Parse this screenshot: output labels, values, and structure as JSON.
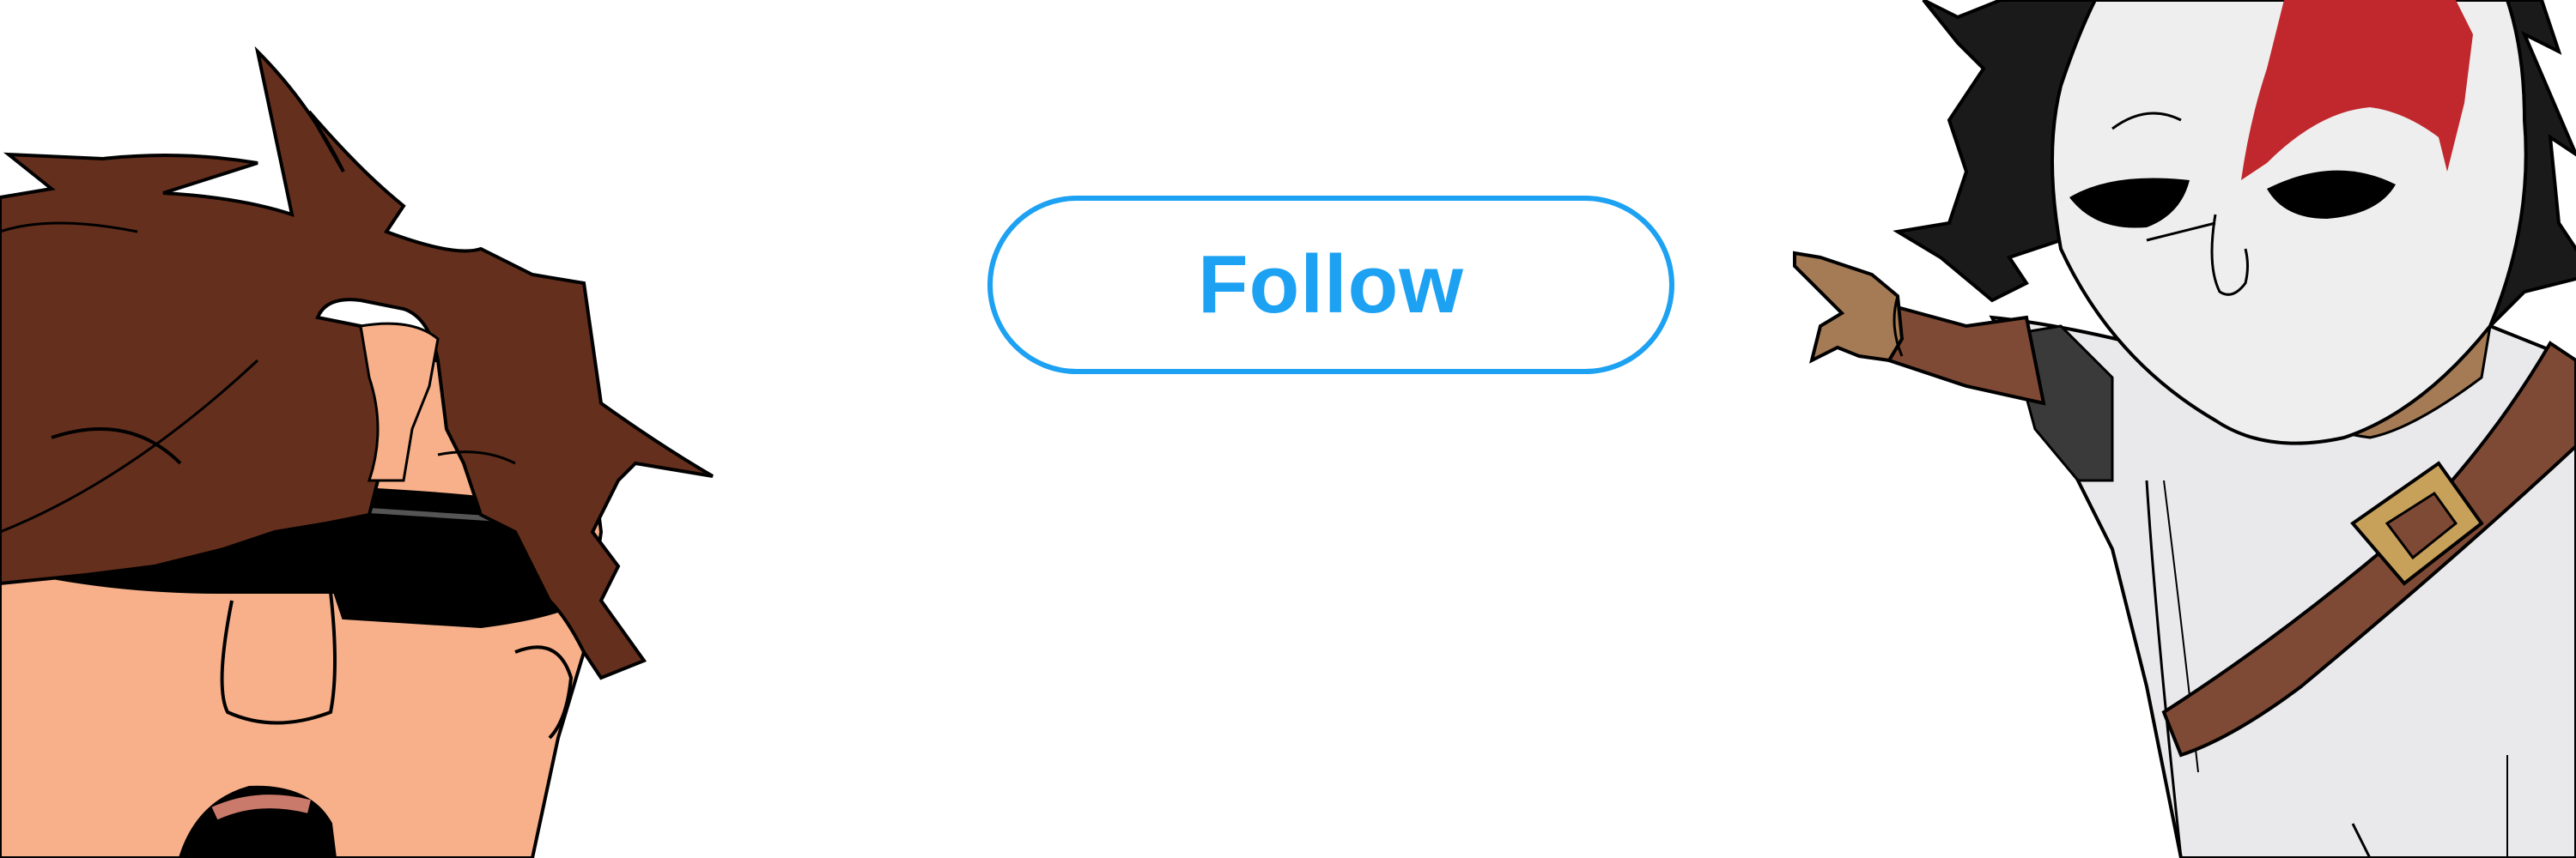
{
  "follow_button": {
    "label": "Follow",
    "color": "#1da1f2",
    "background": "#ffffff"
  },
  "illustration": {
    "left_character": {
      "hair_color": "#652f1d",
      "skin_color": "#f7b08a",
      "sunglasses_color": "#000000"
    },
    "right_character": {
      "hair_color": "#1a1a1a",
      "mask_color": "#eeeeee",
      "mask_mark_color": "#c0282d",
      "strap_color": "#7f4a35",
      "buckle_color": "#c7a05a",
      "glove_color": "#a57b55",
      "robe_color": "#e9e9ec"
    }
  }
}
